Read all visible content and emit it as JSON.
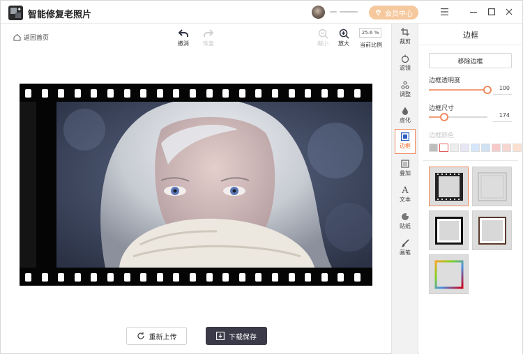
{
  "app": {
    "title": "智能修复老照片",
    "vip_label": "会员中心"
  },
  "toolbar": {
    "back_label": "返回首页",
    "undo_label": "撤消",
    "redo_label": "恢复",
    "zoom_out_label": "缩小",
    "zoom_in_label": "放大",
    "zoom_value": "25.6 %",
    "ratio_label": "当前比例"
  },
  "rail": {
    "items": [
      {
        "label": "裁剪",
        "icon": "crop-icon"
      },
      {
        "label": "滤镜",
        "icon": "filter-icon"
      },
      {
        "label": "调整",
        "icon": "adjust-icon"
      },
      {
        "label": "虚化",
        "icon": "blur-drop-icon"
      },
      {
        "label": "边框",
        "icon": "frame-icon",
        "active": true
      },
      {
        "label": "叠加",
        "icon": "overlay-icon"
      },
      {
        "label": "文本",
        "icon": "text-icon"
      },
      {
        "label": "贴纸",
        "icon": "sticker-icon"
      },
      {
        "label": "画笔",
        "icon": "brush-icon"
      }
    ]
  },
  "panel": {
    "title": "边框",
    "remove_label": "移除边框",
    "opacity_label": "边框透明度",
    "opacity_value": "100",
    "opacity_fraction": 1.0,
    "size_label": "边框尺寸",
    "size_value": "174",
    "size_fraction": 0.26,
    "color_label": "边框颜色",
    "colors": [
      "#bdbdbd",
      "#ffffff",
      "#ededed",
      "#e6e6f5",
      "#d6e6fb",
      "#cfe3f5",
      "#f7c9c9",
      "#f8d6d0",
      "#fbe0cf"
    ],
    "accent": "#f08a5d"
  },
  "actions": {
    "reupload_label": "重新上传",
    "save_label": "下载保存"
  }
}
